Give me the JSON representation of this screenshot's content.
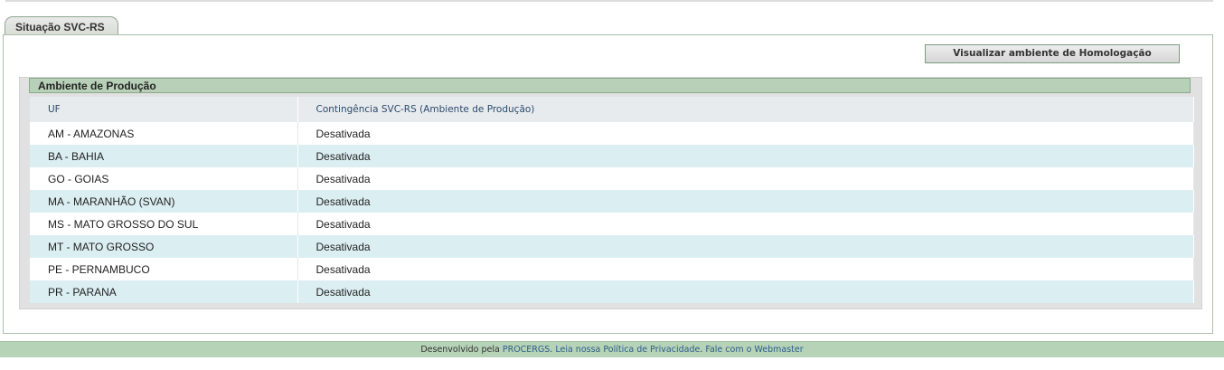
{
  "tab": {
    "label": "Situação SVC-RS"
  },
  "actions": {
    "homolog_button": "Visualizar ambiente de Homologação"
  },
  "section": {
    "title": "Ambiente de Produção",
    "columns": [
      "UF",
      "Contingência SVC-RS (Ambiente de Produção)"
    ],
    "rows": [
      {
        "uf": "AM - AMAZONAS",
        "status": "Desativada"
      },
      {
        "uf": "BA - BAHIA",
        "status": "Desativada"
      },
      {
        "uf": "GO - GOIAS",
        "status": "Desativada"
      },
      {
        "uf": "MA - MARANHÃO (SVAN)",
        "status": "Desativada"
      },
      {
        "uf": "MS - MATO GROSSO DO SUL",
        "status": "Desativada"
      },
      {
        "uf": "MT - MATO GROSSO",
        "status": "Desativada"
      },
      {
        "uf": "PE - PERNAMBUCO",
        "status": "Desativada"
      },
      {
        "uf": "PR - PARANA",
        "status": "Desativada"
      }
    ]
  },
  "footer": {
    "prefix": "Desenvolvido pela ",
    "procergs": "PROCERGS",
    "sep1": ". ",
    "privacy": "Leia nossa Política de Privacidade",
    "sep2": ". ",
    "webmaster": "Fale com o Webmaster"
  }
}
